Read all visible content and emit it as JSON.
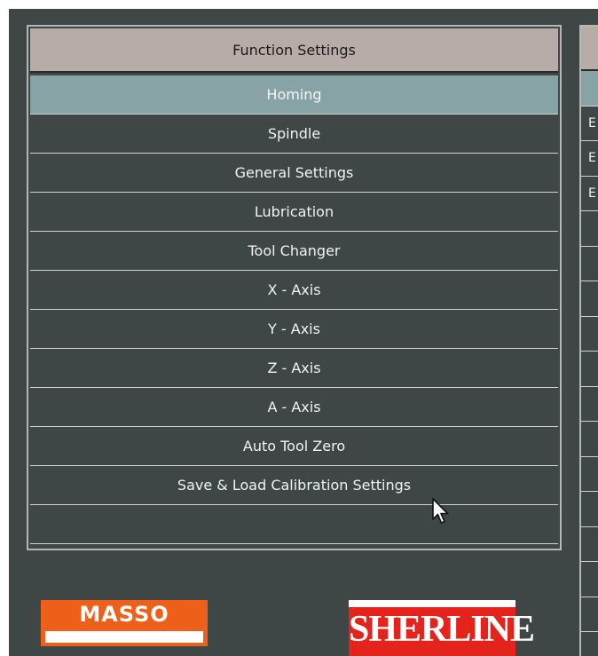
{
  "function_panel": {
    "title": "Function Settings",
    "items": [
      {
        "label": "Homing",
        "selected": true
      },
      {
        "label": "Spindle",
        "selected": false
      },
      {
        "label": "General Settings",
        "selected": false
      },
      {
        "label": "Lubrication",
        "selected": false
      },
      {
        "label": "Tool Changer",
        "selected": false
      },
      {
        "label": "X - Axis",
        "selected": false
      },
      {
        "label": "Y - Axis",
        "selected": false
      },
      {
        "label": "Z - Axis",
        "selected": false
      },
      {
        "label": "A - Axis",
        "selected": false
      },
      {
        "label": "Auto Tool Zero",
        "selected": false
      },
      {
        "label": "Save & Load Calibration Settings",
        "selected": false
      }
    ]
  },
  "right_panel": {
    "row_initials": [
      "",
      "E",
      "E",
      "E",
      "",
      "",
      "",
      "",
      "",
      "",
      "",
      "",
      "",
      "",
      "",
      "",
      ""
    ]
  },
  "logos": {
    "masso": "MASSO",
    "sherline": "SHERLINE"
  },
  "colors": {
    "background": "#3e4646",
    "header": "#b8aca9",
    "selected_row": "#88a3a6",
    "row_divider": "#cfd3d3",
    "masso_orange": "#ee6019",
    "sherline_red": "#e3231c"
  },
  "icons": {
    "cursor": "mouse-pointer-icon"
  }
}
